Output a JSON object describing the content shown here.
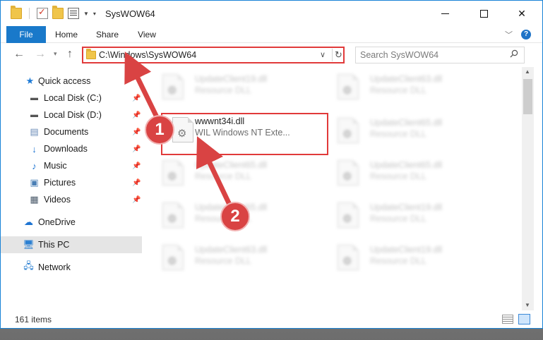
{
  "window": {
    "title": "SysWOW64",
    "controls": {
      "minimize": "minimize",
      "maximize": "maximize",
      "close": "✕"
    }
  },
  "ribbon": {
    "tabs": [
      {
        "label": "File"
      },
      {
        "label": "Home"
      },
      {
        "label": "Share"
      },
      {
        "label": "View"
      }
    ],
    "help": "?"
  },
  "navigation": {
    "address": "C:\\Windows\\SysWOW64",
    "search_placeholder": "Search SysWOW64"
  },
  "sidebar": {
    "items": [
      {
        "label": "Quick access",
        "icon": "star-icon"
      },
      {
        "label": "Local Disk (C:)",
        "icon": "drive-icon"
      },
      {
        "label": "Local Disk (D:)",
        "icon": "drive-icon"
      },
      {
        "label": "Documents",
        "icon": "documents-icon"
      },
      {
        "label": "Downloads",
        "icon": "download-arrow-icon"
      },
      {
        "label": "Music",
        "icon": "music-note-icon"
      },
      {
        "label": "Pictures",
        "icon": "pictures-icon"
      },
      {
        "label": "Videos",
        "icon": "film-icon"
      },
      {
        "label": "OneDrive",
        "icon": "cloud-icon"
      },
      {
        "label": "This PC",
        "icon": "monitor-icon"
      },
      {
        "label": "Network",
        "icon": "network-icon"
      }
    ]
  },
  "files": [
    {
      "name": "UpdateClient19.dll",
      "description": "Resource DLL"
    },
    {
      "name": "UpdateClient63.dll",
      "description": "Resource DLL"
    },
    {
      "name": "wwwnt34i.dll",
      "description": "WIL Windows NT Exte..."
    },
    {
      "name": "UpdateClient65.dll",
      "description": "Resource DLL"
    },
    {
      "name": "UpdateClient65.dll",
      "description": "Resource DLL"
    },
    {
      "name": "UpdateClient65.dll",
      "description": "Resource DLL"
    },
    {
      "name": "UpdateClient65.dll",
      "description": "Resource DLL"
    },
    {
      "name": "UpdateClient19.dll",
      "description": "Resource DLL"
    },
    {
      "name": "UpdateClient63.dll",
      "description": "Resource DLL"
    },
    {
      "name": "UpdateClient19.dll",
      "description": "Resource DLL"
    }
  ],
  "status": {
    "item_count": "161 items"
  },
  "annotations": {
    "step1": "1",
    "step2": "2",
    "accent_color": "#d94343"
  }
}
